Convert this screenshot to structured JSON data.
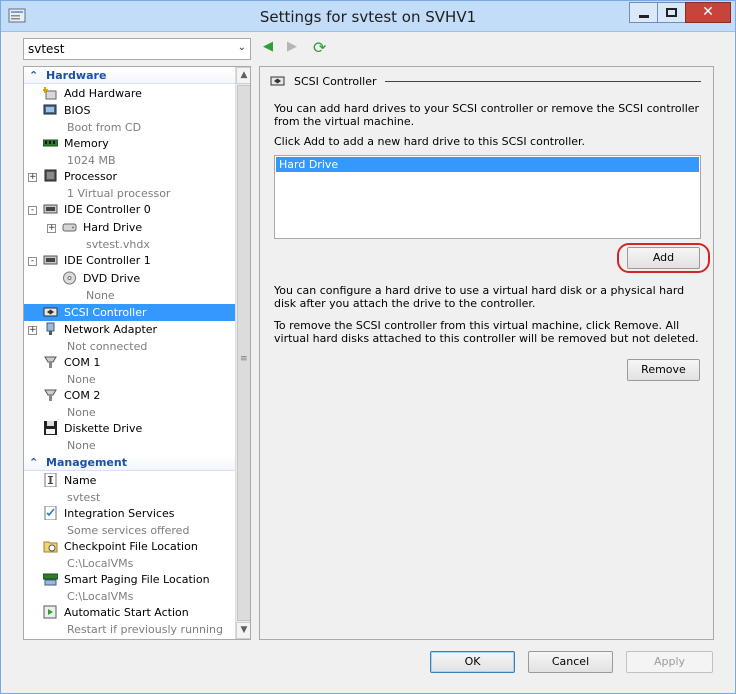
{
  "window": {
    "title": "Settings for svtest on SVHV1",
    "close_label": "✕"
  },
  "vm_selector": {
    "value": "svtest",
    "arrow": "⌄"
  },
  "nav": {
    "back": "◀",
    "forward": "▶",
    "refresh": "⟳"
  },
  "sidebar": {
    "hardware_header": "Hardware",
    "management_header": "Management",
    "items": [
      {
        "label": "Add Hardware",
        "sub": "",
        "icon": "add-hardware-icon"
      },
      {
        "label": "BIOS",
        "sub": "Boot from CD",
        "icon": "bios-icon"
      },
      {
        "label": "Memory",
        "sub": "1024 MB",
        "icon": "memory-icon"
      },
      {
        "label": "Processor",
        "sub": "1 Virtual processor",
        "icon": "processor-icon"
      },
      {
        "label": "IDE Controller 0",
        "sub": "",
        "icon": "ide-controller-icon"
      },
      {
        "label": "Hard Drive",
        "sub": "svtest.vhdx",
        "icon": "hard-drive-icon"
      },
      {
        "label": "IDE Controller 1",
        "sub": "",
        "icon": "ide-controller-icon"
      },
      {
        "label": "DVD Drive",
        "sub": "None",
        "icon": "dvd-drive-icon"
      },
      {
        "label": "SCSI Controller",
        "sub": "",
        "icon": "scsi-controller-icon"
      },
      {
        "label": "Network Adapter",
        "sub": "Not connected",
        "icon": "network-adapter-icon"
      },
      {
        "label": "COM 1",
        "sub": "None",
        "icon": "com-port-icon"
      },
      {
        "label": "COM 2",
        "sub": "None",
        "icon": "com-port-icon"
      },
      {
        "label": "Diskette Drive",
        "sub": "None",
        "icon": "diskette-icon"
      }
    ],
    "management_items": [
      {
        "label": "Name",
        "sub": "svtest",
        "icon": "name-icon"
      },
      {
        "label": "Integration Services",
        "sub": "Some services offered",
        "icon": "integration-services-icon"
      },
      {
        "label": "Checkpoint File Location",
        "sub": "C:\\LocalVMs",
        "icon": "checkpoint-icon"
      },
      {
        "label": "Smart Paging File Location",
        "sub": "C:\\LocalVMs",
        "icon": "smart-paging-icon"
      },
      {
        "label": "Automatic Start Action",
        "sub": "Restart if previously running",
        "icon": "auto-start-icon"
      }
    ],
    "expanders": [
      "+",
      "+",
      "-",
      "+",
      "-",
      "+"
    ]
  },
  "panel": {
    "title": "SCSI Controller",
    "intro": "You can add hard drives to your SCSI controller or remove the SCSI controller from the virtual machine.",
    "click_add": "Click Add to add a new hard drive to this SCSI controller.",
    "list_items": [
      "Hard Drive"
    ],
    "add_label": "Add",
    "configure_text": "You can configure a hard drive to use a virtual hard disk or a physical hard disk after you attach the drive to the controller.",
    "remove_text": "To remove the SCSI controller from this virtual machine, click Remove. All virtual hard disks attached to this controller will be removed but not deleted.",
    "remove_label": "Remove"
  },
  "footer": {
    "ok_label": "OK",
    "cancel_label": "Cancel",
    "apply_label": "Apply"
  },
  "colors": {
    "selection": "#3399ff",
    "section_header": "#1c4fa6",
    "highlight_ring": "#d42525"
  }
}
